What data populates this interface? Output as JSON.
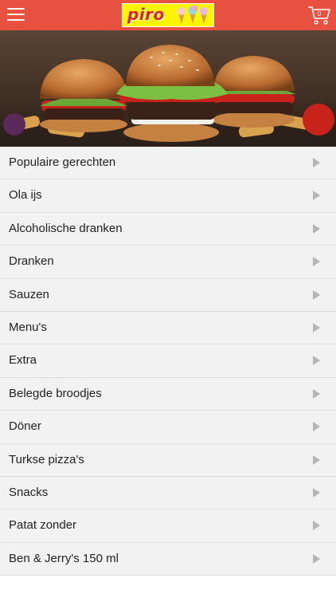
{
  "header": {
    "logo_text": "piro",
    "cart_count": "0",
    "accent_color": "#e8503f"
  },
  "icons": {
    "menu": "hamburger-icon",
    "cart": "shopping-cart-icon",
    "row_arrow": "chevron-right-icon"
  },
  "categories": [
    "Populaire gerechten",
    "Ola ijs",
    "Alcoholische dranken",
    "Dranken",
    "Sauzen",
    "Menu's",
    "Extra",
    "Belegde broodjes",
    "Döner",
    "Turkse pizza's",
    "Snacks",
    "Patat zonder",
    "Ben & Jerry's 150 ml"
  ]
}
